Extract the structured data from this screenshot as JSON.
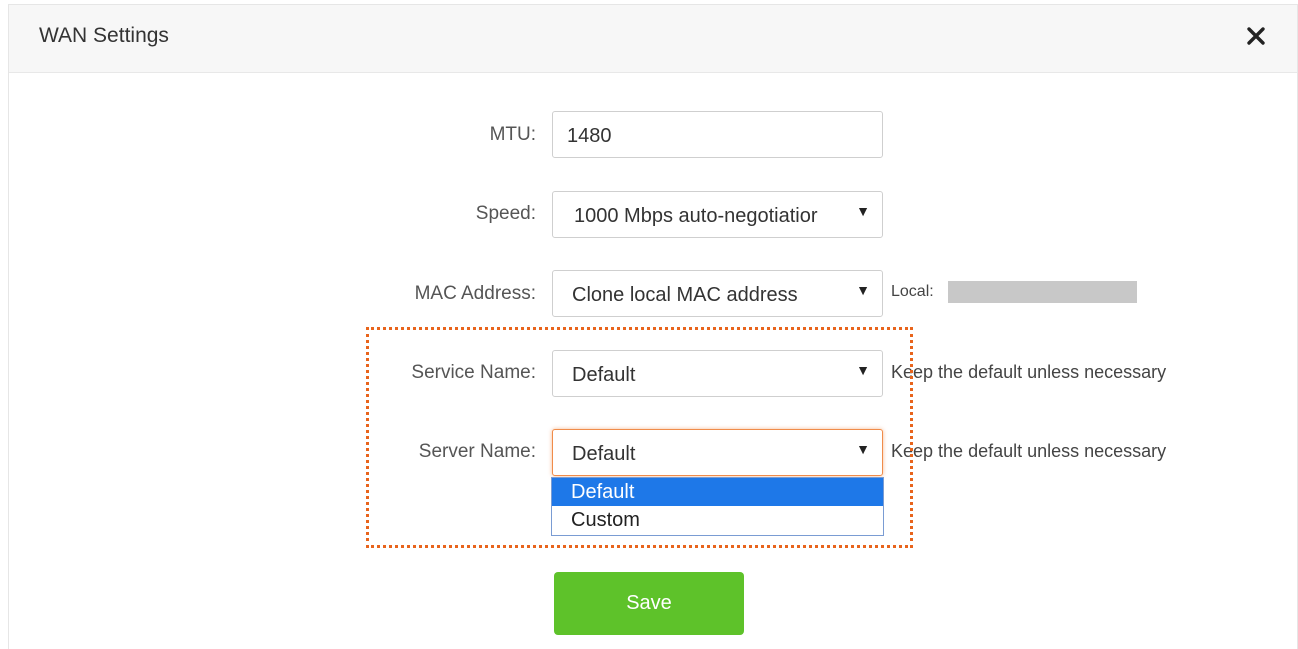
{
  "dialog": {
    "title": "WAN Settings",
    "close_icon": "close-icon"
  },
  "form": {
    "mtu": {
      "label": "MTU:",
      "value": "1480"
    },
    "speed": {
      "label": "Speed:",
      "value": "1000 Mbps auto-negotiatior"
    },
    "mac": {
      "label": "MAC Address:",
      "value": "Clone local MAC address",
      "note": "Local:"
    },
    "service_name": {
      "label": "Service Name:",
      "value": "Default",
      "note": "Keep the default unless necessary"
    },
    "server_name": {
      "label": "Server Name:",
      "value": "Default",
      "note": "Keep the default unless necessary",
      "options": [
        "Default",
        "Custom"
      ]
    }
  },
  "save_label": "Save",
  "colors": {
    "accent": "#5ec22a",
    "selected_option": "#1e78e8",
    "highlight": "#e8641c"
  }
}
